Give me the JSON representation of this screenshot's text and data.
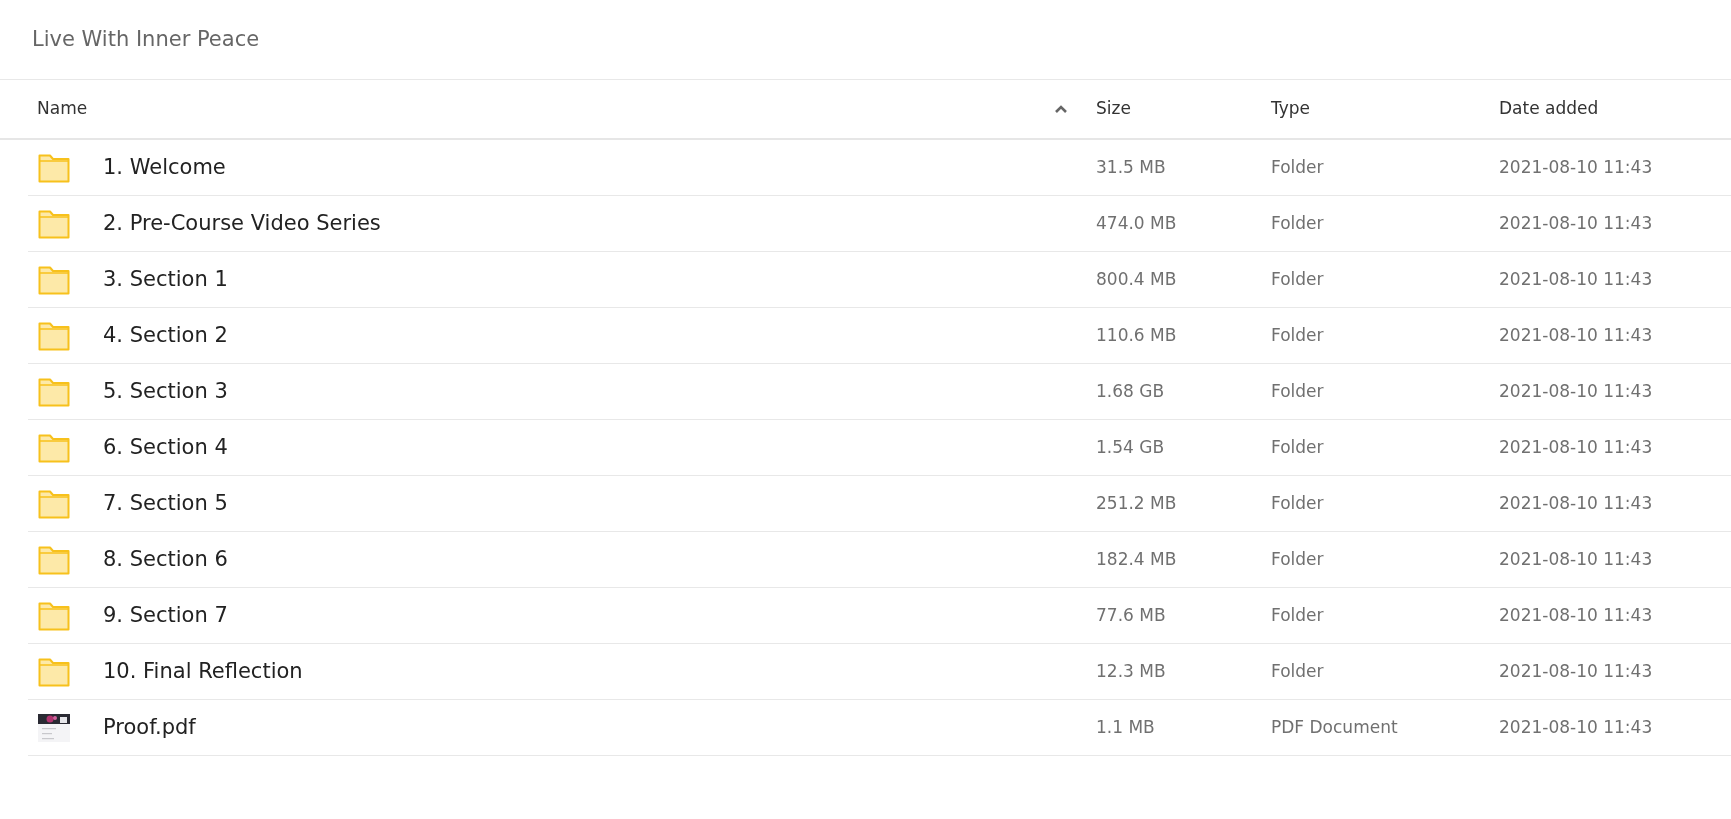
{
  "title": "Live With Inner Peace",
  "table": {
    "columns": [
      {
        "label": "Name",
        "sorted_ascending": true
      },
      {
        "label": "Size"
      },
      {
        "label": "Type"
      },
      {
        "label": "Date added"
      }
    ],
    "rows": [
      {
        "kind": "folder",
        "name": "1. Welcome",
        "size": "31.5 MB",
        "type": "Folder",
        "date": "2021-08-10 11:43"
      },
      {
        "kind": "folder",
        "name": "2. Pre-Course Video Series",
        "size": "474.0 MB",
        "type": "Folder",
        "date": "2021-08-10 11:43"
      },
      {
        "kind": "folder",
        "name": "3. Section 1",
        "size": "800.4 MB",
        "type": "Folder",
        "date": "2021-08-10 11:43"
      },
      {
        "kind": "folder",
        "name": "4. Section 2",
        "size": "110.6 MB",
        "type": "Folder",
        "date": "2021-08-10 11:43"
      },
      {
        "kind": "folder",
        "name": "5. Section 3",
        "size": "1.68 GB",
        "type": "Folder",
        "date": "2021-08-10 11:43"
      },
      {
        "kind": "folder",
        "name": "6. Section 4",
        "size": "1.54 GB",
        "type": "Folder",
        "date": "2021-08-10 11:43"
      },
      {
        "kind": "folder",
        "name": "7. Section 5",
        "size": "251.2 MB",
        "type": "Folder",
        "date": "2021-08-10 11:43"
      },
      {
        "kind": "folder",
        "name": "8. Section 6",
        "size": "182.4 MB",
        "type": "Folder",
        "date": "2021-08-10 11:43"
      },
      {
        "kind": "folder",
        "name": "9. Section 7",
        "size": "77.6 MB",
        "type": "Folder",
        "date": "2021-08-10 11:43"
      },
      {
        "kind": "folder",
        "name": "10. Final Reflection",
        "size": "12.3 MB",
        "type": "Folder",
        "date": "2021-08-10 11:43"
      },
      {
        "kind": "pdf",
        "name": "Proof.pdf",
        "size": "1.1 MB",
        "type": "PDF Document",
        "date": "2021-08-10 11:43"
      }
    ]
  }
}
